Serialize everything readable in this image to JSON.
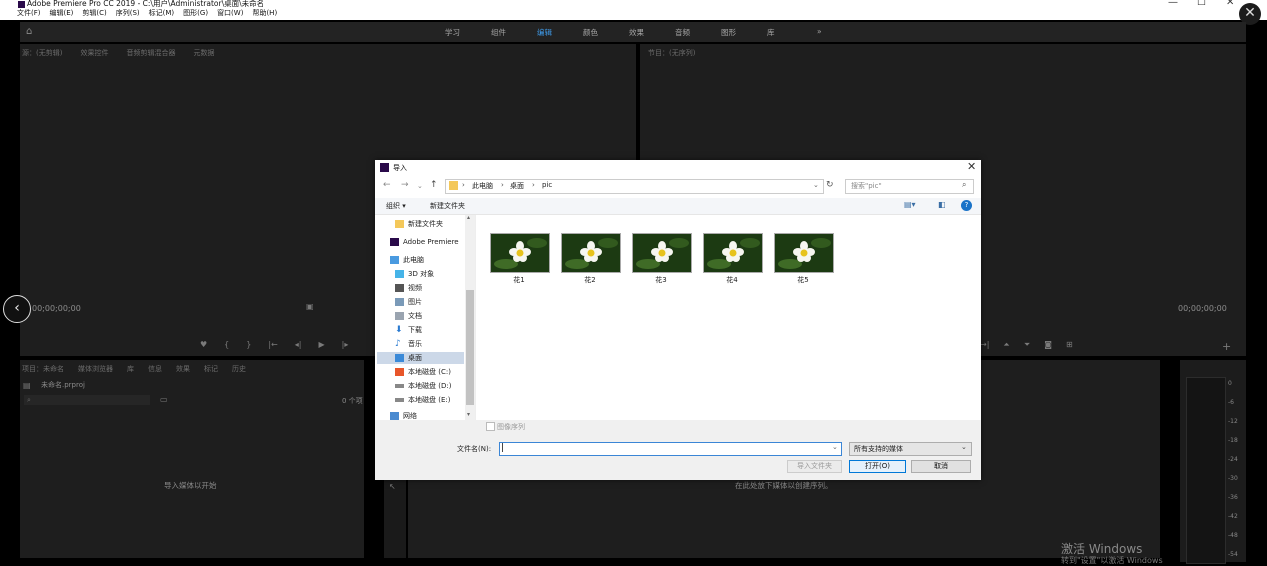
{
  "window": {
    "title": "Adobe Premiere Pro CC 2019 - C:\\用户\\Administrator\\桌面\\未命名",
    "controls": {
      "minimize": "—",
      "maximize": "☐",
      "close": "✕"
    }
  },
  "menu": [
    "文件(F)",
    "编辑(E)",
    "剪辑(C)",
    "序列(S)",
    "标记(M)",
    "图形(G)",
    "窗口(W)",
    "帮助(H)"
  ],
  "workspaces": [
    "学习",
    "组件",
    "编辑",
    "颜色",
    "效果",
    "音频",
    "图形",
    "库"
  ],
  "workspace_overflow": "»",
  "source_panel": {
    "tabs": [
      "源：(无剪辑)",
      "效果控件",
      "音频剪辑混合器",
      "元数据"
    ],
    "timecode_left": "00;00;00;00"
  },
  "program_panel": {
    "tab": "节目：(无序列)",
    "timecode_right": "00;00;00;00"
  },
  "project_panel": {
    "tabs": [
      "项目：未命名",
      "媒体浏览器",
      "库",
      "信息",
      "效果",
      "标记",
      "历史"
    ],
    "file": "未命名.prproj",
    "count": "0 个项",
    "empty_hint": "导入媒体以开始"
  },
  "timeline_hint": "在此处放下媒体以创建序列。",
  "audio_meter": {
    "scale": [
      "0",
      "-6",
      "-12",
      "-18",
      "-24",
      "-30",
      "-36",
      "-42",
      "-48",
      "-54"
    ]
  },
  "watermark": {
    "line1": "激活 Windows",
    "line2": "转到\"设置\"以激活 Windows"
  },
  "dialog": {
    "title": "导入",
    "breadcrumb": [
      "此电脑",
      "桌面",
      "pic"
    ],
    "search_placeholder": "搜索\"pic\"",
    "organize": "组织 ▾",
    "new_folder": "新建文件夹",
    "sidebar": [
      {
        "label": "新建文件夹",
        "icon": "folder-icon"
      },
      {
        "label": "Adobe Premiere",
        "icon": "premiere-icon"
      },
      {
        "label": "此电脑",
        "icon": "computer-icon"
      },
      {
        "label": "3D 对象",
        "icon": "cube-icon"
      },
      {
        "label": "视频",
        "icon": "video-icon"
      },
      {
        "label": "图片",
        "icon": "picture-icon"
      },
      {
        "label": "文档",
        "icon": "document-icon"
      },
      {
        "label": "下载",
        "icon": "download-icon"
      },
      {
        "label": "音乐",
        "icon": "music-icon"
      },
      {
        "label": "桌面",
        "icon": "desktop-icon"
      },
      {
        "label": "本地磁盘 (C:)",
        "icon": "disk-icon"
      },
      {
        "label": "本地磁盘 (D:)",
        "icon": "disk-icon"
      },
      {
        "label": "本地磁盘 (E:)",
        "icon": "disk-icon"
      },
      {
        "label": "网络",
        "icon": "network-icon"
      }
    ],
    "files": [
      "花1",
      "花2",
      "花3",
      "花4",
      "花5"
    ],
    "image_sequence": "图像序列",
    "filename_label": "文件名(N):",
    "filename_value": "",
    "filetype": "所有支持的媒体",
    "import_folder": "导入文件夹",
    "open": "打开(O)",
    "cancel": "取消"
  }
}
